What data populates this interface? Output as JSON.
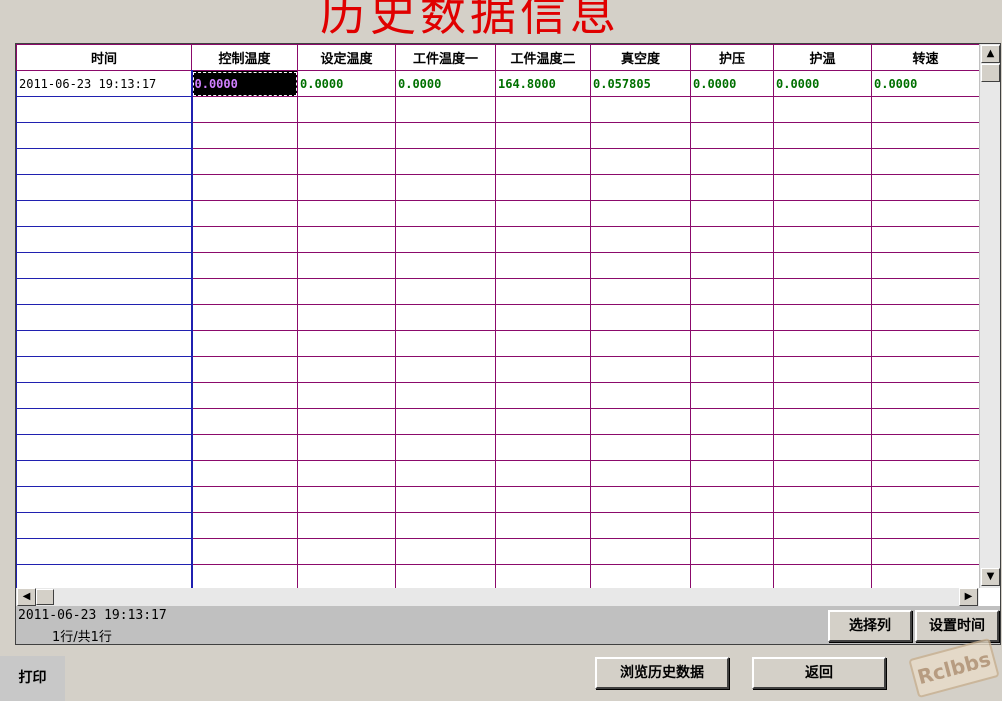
{
  "title": "历史数据信息",
  "columns": [
    "时间",
    "控制温度",
    "设定温度",
    "工件温度一",
    "工件温度二",
    "真空度",
    "护压",
    "护温",
    "转速"
  ],
  "rows": [
    [
      "2011-06-23 19:13:17",
      "0.0000",
      "0.0000",
      "0.0000",
      "164.8000",
      "0.057805",
      "0.0000",
      "0.0000",
      "0.0000"
    ]
  ],
  "status": {
    "timestamp": "2011-06-23 19:13:17",
    "row_count": "1行/共1行"
  },
  "buttons": {
    "select_columns": "选择列",
    "set_time": "设置时间",
    "browse_history": "浏览历史数据",
    "back": "返回",
    "print": "打印"
  },
  "watermark": "Rclbbs",
  "colors": {
    "title": "#e00000",
    "grid_line": "#8b0a6b",
    "value_text": "#007000",
    "selected_text": "#d080ff"
  }
}
